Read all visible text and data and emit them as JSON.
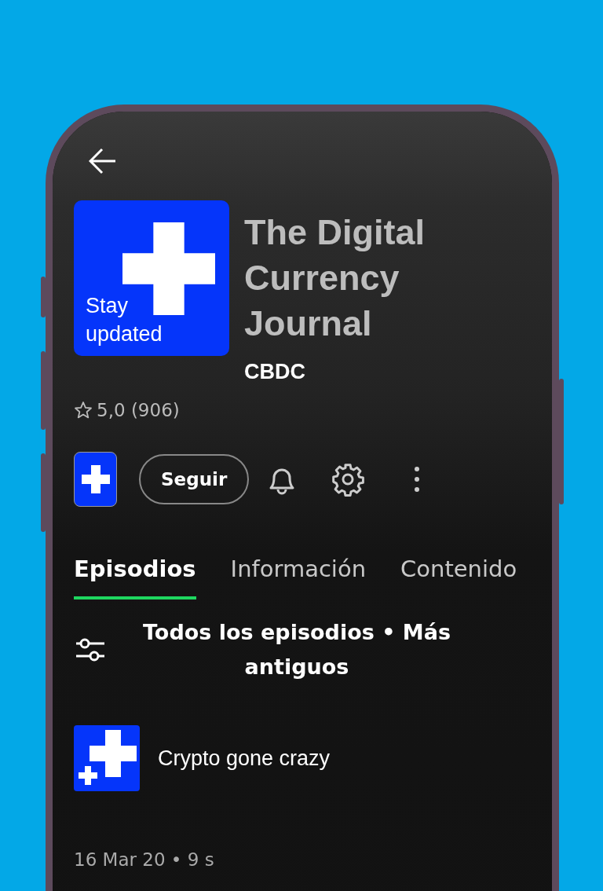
{
  "podcast": {
    "cover_text": "Stay updated",
    "title": "The Digital Currency Journal",
    "author": "CBDC",
    "rating": "5,0 (906)"
  },
  "actions": {
    "follow_label": "Seguir"
  },
  "tabs": [
    {
      "label": "Episodios",
      "selected": true
    },
    {
      "label": "Información",
      "selected": false
    },
    {
      "label": "Contenido",
      "selected": false
    }
  ],
  "filter": {
    "label": "Todos los episodios • Más antiguos"
  },
  "episodes": [
    {
      "title": "Crypto gone crazy",
      "meta": "16 Mar 20 • 9 s"
    }
  ]
}
